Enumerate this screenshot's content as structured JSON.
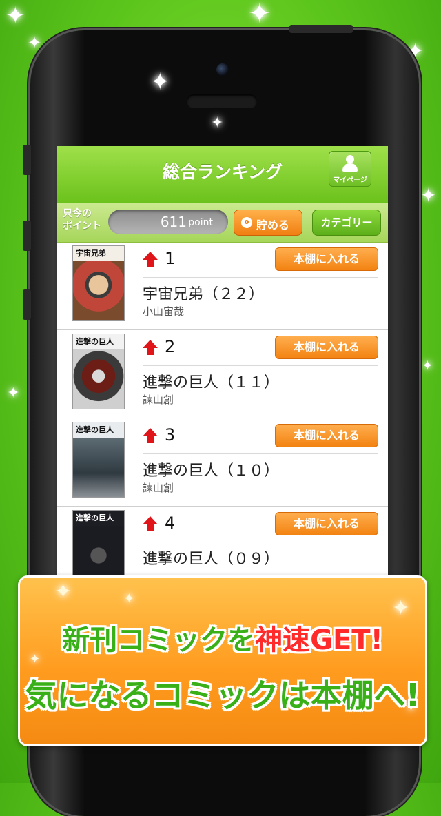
{
  "nav": {
    "title": "総合ランキング",
    "mypage_label": "マイページ"
  },
  "points": {
    "label_line1": "只今の",
    "label_line2": "ポイント",
    "value": "611",
    "unit": "point",
    "save_label": "貯める",
    "category_label": "カテゴリー"
  },
  "ranking": [
    {
      "rank": "1",
      "title": "宇宙兄弟（２２）",
      "author": "小山宙哉",
      "button": "本棚に入れる",
      "trend": "up",
      "cover_text": "宇宙兄弟"
    },
    {
      "rank": "2",
      "title": "進撃の巨人（１１）",
      "author": "諫山創",
      "button": "本棚に入れる",
      "trend": "up",
      "cover_text": "進撃の巨人"
    },
    {
      "rank": "3",
      "title": "進撃の巨人（１０）",
      "author": "諫山創",
      "button": "本棚に入れる",
      "trend": "up",
      "cover_text": "進撃の巨人"
    },
    {
      "rank": "4",
      "title": "進撃の巨人（０９）",
      "author": "",
      "button": "本棚に入れる",
      "trend": "up",
      "cover_text": "進撃の巨人"
    }
  ],
  "banner": {
    "line1_a": "新刊コミックを",
    "line1_b": "神速GET!",
    "line2": "気になるコミックは本棚へ!"
  },
  "colors": {
    "accent_green": "#6cc21c",
    "button_orange": "#f28312",
    "trend_red": "#e0151a",
    "background_green": "#5cc51c"
  }
}
